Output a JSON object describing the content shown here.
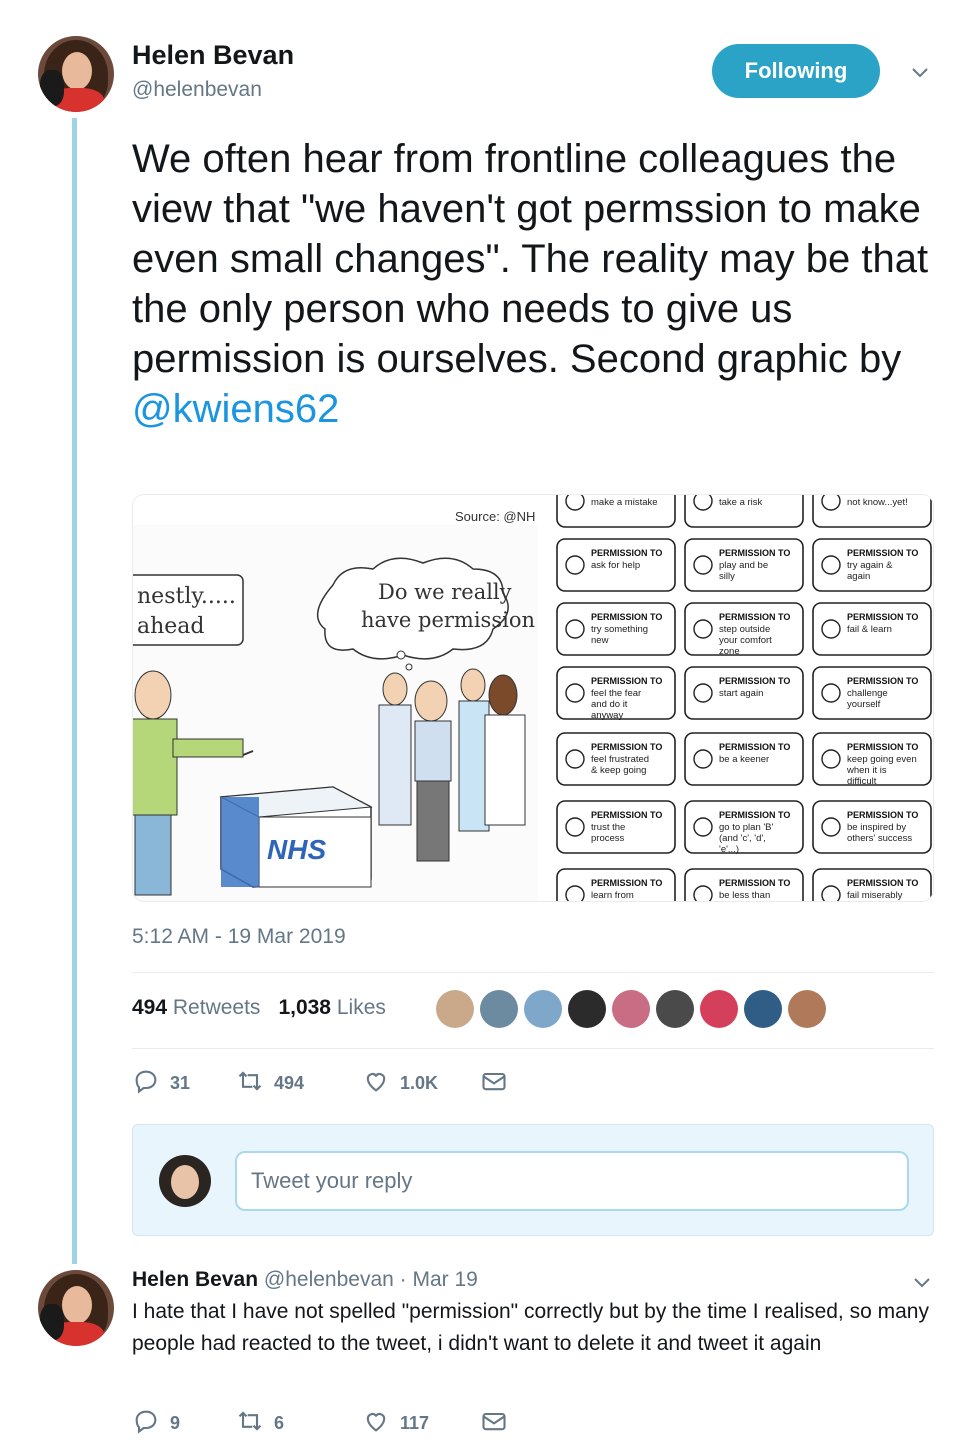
{
  "tweet": {
    "author_name": "Helen Bevan",
    "author_handle": "@helenbevan",
    "follow_label": "Following",
    "text": "We often hear from frontline colleagues the view that \"we haven't got permssion to make even small changes\". The reality may be that the only person who needs to give us permission is ourselves. Second graphic by",
    "mention": "@kwiens62",
    "timestamp": "5:12 AM - 19 Mar 2019",
    "retweets_count": "494",
    "retweets_label": "Retweets",
    "likes_count": "1,038",
    "likes_label": "Likes",
    "actions": {
      "replies": "31",
      "retweets": "494",
      "likes": "1.0K"
    }
  },
  "media": {
    "cartoon": {
      "source": "Source: @NH",
      "speech_left_1": "nestly.....",
      "speech_left_2": "ahead",
      "thought_1": "Do we really",
      "thought_2": "have permission",
      "box_label": "NHS"
    },
    "cards": [
      {
        "title": "",
        "text": "make a mistake"
      },
      {
        "title": "",
        "text": "take a risk"
      },
      {
        "title": "",
        "text": "not know...yet!"
      },
      {
        "title": "PERMISSION TO",
        "text": "ask for help"
      },
      {
        "title": "PERMISSION TO",
        "text": "play and be silly"
      },
      {
        "title": "PERMISSION TO",
        "text": "try again & again"
      },
      {
        "title": "PERMISSION TO",
        "text": "try something new"
      },
      {
        "title": "PERMISSION TO",
        "text": "step outside your comfort zone"
      },
      {
        "title": "PERMISSION TO",
        "text": "fail & learn"
      },
      {
        "title": "PERMISSION TO",
        "text": "feel the fear and do it anyway"
      },
      {
        "title": "PERMISSION TO",
        "text": "start again"
      },
      {
        "title": "PERMISSION TO",
        "text": "challenge yourself"
      },
      {
        "title": "PERMISSION TO",
        "text": "feel frustrated & keep going"
      },
      {
        "title": "PERMISSION TO",
        "text": "be a keener"
      },
      {
        "title": "PERMISSION TO",
        "text": "keep going even when it is difficult"
      },
      {
        "title": "PERMISSION TO",
        "text": "trust the process"
      },
      {
        "title": "PERMISSION TO",
        "text": "go to plan 'B' (and 'c', 'd', 'e'...)"
      },
      {
        "title": "PERMISSION TO",
        "text": "be inspired by others' success"
      },
      {
        "title": "PERMISSION TO",
        "text": "learn from"
      },
      {
        "title": "PERMISSION TO",
        "text": "be less than"
      },
      {
        "title": "PERMISSION TO",
        "text": "fail miserably"
      }
    ]
  },
  "reply_box": {
    "placeholder": "Tweet your reply"
  },
  "reply": {
    "author_name": "Helen Bevan",
    "author_handle": "@helenbevan",
    "date": "· Mar 19",
    "text": "I hate that I have not spelled \"permission\" correctly but by the time I realised, so many people had reacted to the tweet, i didn't want to delete it and tweet it again",
    "actions": {
      "replies": "9",
      "retweets": "6",
      "likes": "117"
    }
  },
  "colors": {
    "accent": "#1b95e0",
    "follow_bg": "#2aa3c7",
    "thread_line": "#9fd4e6",
    "muted": "#657786"
  },
  "icons": [
    "reply-icon",
    "retweet-icon",
    "heart-icon",
    "message-icon",
    "chevron-down-icon"
  ]
}
